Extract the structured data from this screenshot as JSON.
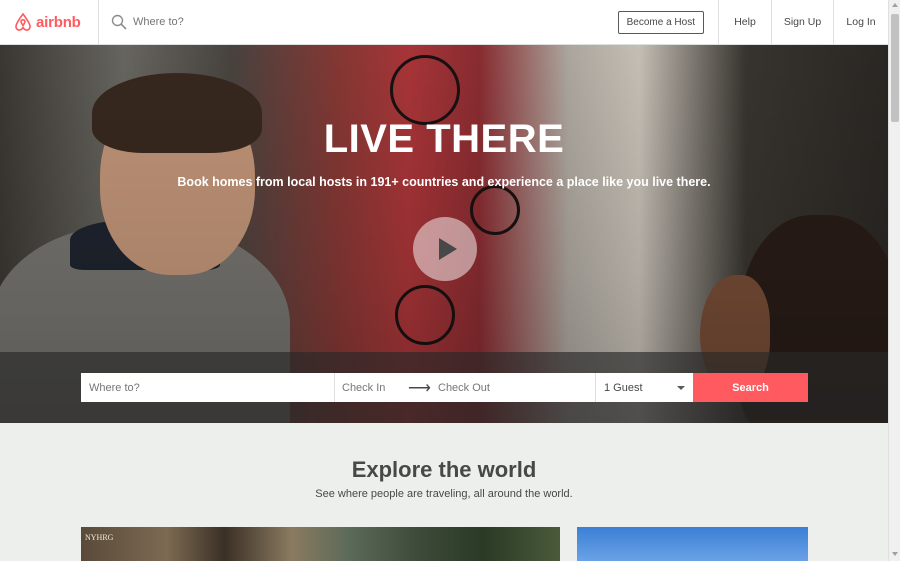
{
  "header": {
    "logo_text": "airbnb",
    "search_placeholder": "Where to?",
    "become_host": "Become a Host",
    "help": "Help",
    "sign_up": "Sign Up",
    "log_in": "Log In"
  },
  "hero": {
    "title": "LIVE THERE",
    "subtitle": "Book homes from local hosts in 191+ countries and experience a place like you live there."
  },
  "search": {
    "where_placeholder": "Where to?",
    "check_in": "Check In",
    "check_out": "Check Out",
    "guests": "1 Guest",
    "button": "Search"
  },
  "explore": {
    "title": "Explore the world",
    "subtitle": "See where people are traveling, all around the world.",
    "card_sign": "NYHRG"
  },
  "colors": {
    "brand": "#ff5a5f",
    "text": "#484848",
    "section_bg": "#edefed"
  }
}
